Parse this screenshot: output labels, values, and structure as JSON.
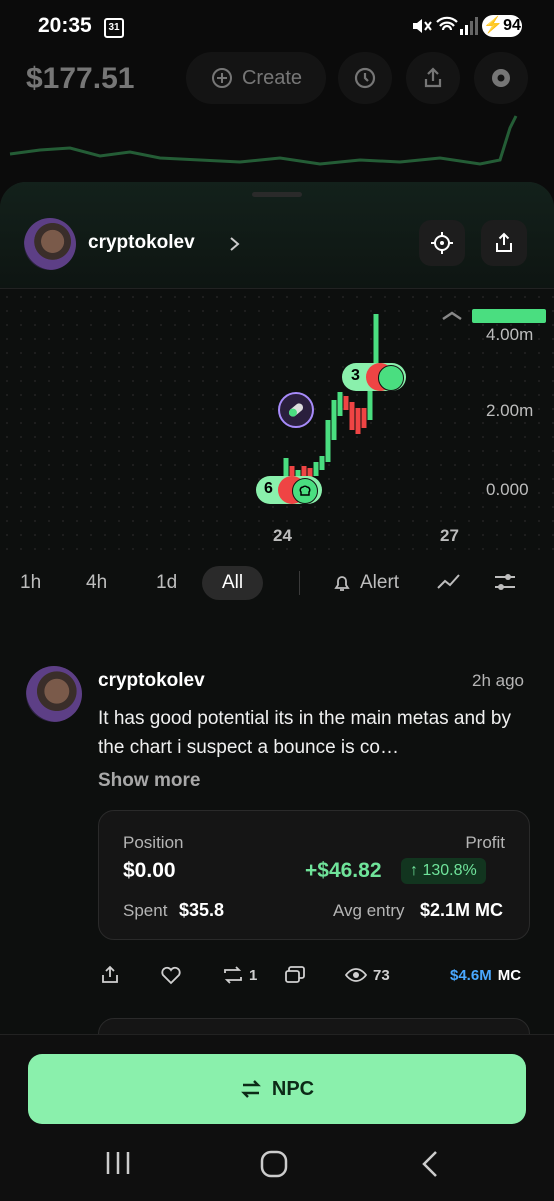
{
  "status_bar": {
    "time": "20:35",
    "calendar_day": "31",
    "battery": "94"
  },
  "top_bar": {
    "balance": "$177.51",
    "create_label": "Create"
  },
  "profile": {
    "username": "cryptokolev"
  },
  "chart": {
    "y_labels": [
      "4.00m",
      "2.00m",
      "0.000"
    ],
    "x_labels": [
      "24",
      "27"
    ],
    "marker_top_count": "3",
    "marker_bottom_count": "6"
  },
  "chart_data": {
    "type": "candlestick",
    "x_ticks": [
      "24",
      "27"
    ],
    "y_ticks": [
      "0.000",
      "2.00m",
      "4.00m"
    ]
  },
  "timeframes": {
    "items": [
      "1h",
      "4h",
      "1d",
      "All"
    ],
    "selected": "All",
    "alert_label": "Alert"
  },
  "post": {
    "username": "cryptokolev",
    "time_ago": "2h ago",
    "text": "It has good potential its in the main metas and by the chart i suspect a bounce is co…",
    "show_more": "Show more",
    "position_label": "Position",
    "position_value": "$0.00",
    "profit_label": "Profit",
    "profit_value": "+$46.82",
    "profit_pct": "↑ 130.8%",
    "spent_label": "Spent",
    "spent_value": "$35.8",
    "avg_entry_label": "Avg entry",
    "avg_entry_value": "$2.1M MC",
    "reposts": "1",
    "views": "73",
    "mc_value": "$4.6M",
    "mc_label": "MC"
  },
  "bottom": {
    "npc_label": "NPC"
  },
  "colors": {
    "accent_green": "#8af0ac",
    "profit_green": "#6fe39a",
    "candle_up": "#4ade80",
    "candle_down": "#ef4444",
    "mc_blue": "#4aa8ff"
  }
}
